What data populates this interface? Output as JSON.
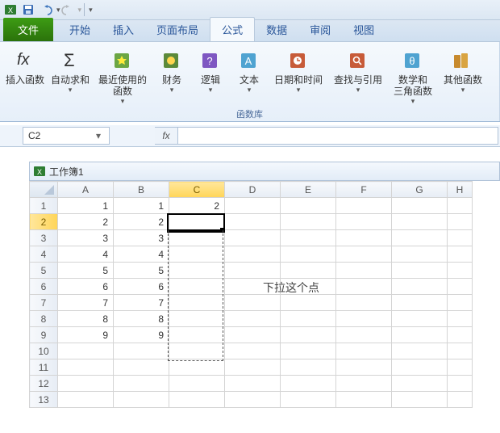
{
  "qat": {
    "save_tip": "保存",
    "undo_tip": "撤销",
    "redo_tip": "重做"
  },
  "tabs": {
    "file": "文件",
    "home": "开始",
    "insert": "插入",
    "layout": "页面布局",
    "formulas": "公式",
    "data": "数据",
    "review": "审阅",
    "view": "视图"
  },
  "ribbon": {
    "group_label": "函数库",
    "insert_fn": "插入函数",
    "autosum": "自动求和",
    "recent": "最近使用的\n函数",
    "financial": "财务",
    "logical": "逻辑",
    "text": "文本",
    "datetime": "日期和时间",
    "lookup": "查找与引用",
    "mathtrig": "数学和\n三角函数",
    "more": "其他函数",
    "dd": "▾"
  },
  "namebox": {
    "value": "C2",
    "dd": "▾"
  },
  "fx": "fx",
  "workbook": {
    "title": "工作簿1"
  },
  "columns": [
    "A",
    "B",
    "C",
    "D",
    "E",
    "F",
    "G",
    "H"
  ],
  "rows": [
    "1",
    "2",
    "3",
    "4",
    "5",
    "6",
    "7",
    "8",
    "9",
    "10",
    "11",
    "12",
    "13"
  ],
  "cells": {
    "A": {
      "1": "1",
      "2": "2",
      "3": "3",
      "4": "4",
      "5": "5",
      "6": "6",
      "7": "7",
      "8": "8",
      "9": "9"
    },
    "B": {
      "1": "1",
      "2": "2",
      "3": "3",
      "4": "4",
      "5": "5",
      "6": "6",
      "7": "7",
      "8": "8",
      "9": "9"
    },
    "C": {
      "1": "2"
    }
  },
  "annotation": "下拉这个点"
}
